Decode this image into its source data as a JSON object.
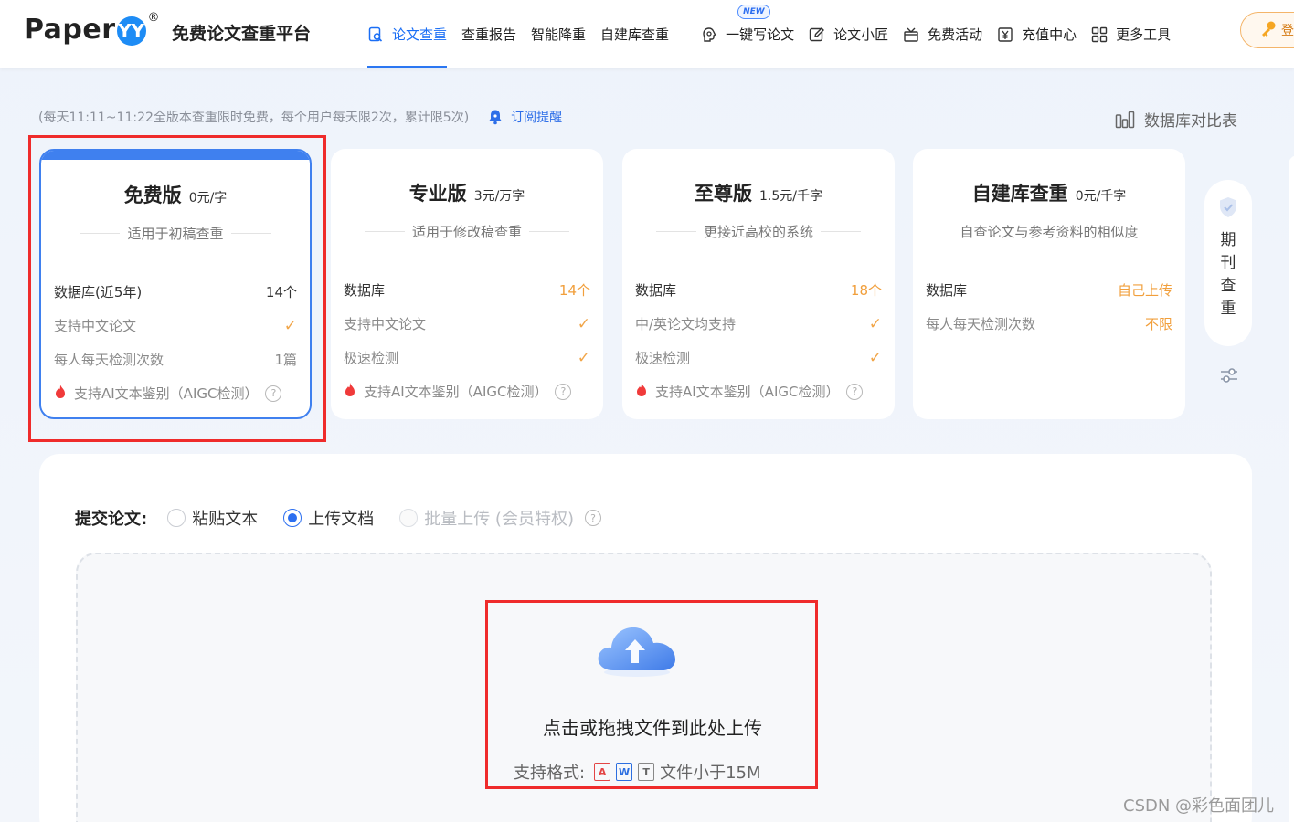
{
  "header": {
    "logo_text": "Paper",
    "logo_badge": "YY",
    "logo_reg": "®",
    "platform_name": "免费论文查重平台",
    "nav": [
      {
        "label": "论文查重",
        "icon": "search-doc-icon"
      },
      {
        "label": "查重报告"
      },
      {
        "label": "智能降重"
      },
      {
        "label": "自建库查重"
      },
      {
        "label": "一键写论文",
        "icon": "ai-brain-icon",
        "badge": "NEW"
      },
      {
        "label": "论文小匠",
        "icon": "pen-icon"
      },
      {
        "label": "免费活动",
        "icon": "gift-icon"
      },
      {
        "label": "充值中心",
        "icon": "yuan-icon"
      },
      {
        "label": "更多工具",
        "icon": "grid-icon"
      }
    ],
    "vip_label": "登"
  },
  "notice": {
    "text": "(每天11:11~11:22全版本查重限时免费，每个用户每天限2次，累计限5次)",
    "subscribe": "订阅提醒",
    "db_compare": "数据库对比表"
  },
  "plans": [
    {
      "name": "免费版",
      "price": "0元/字",
      "desc": "适用于初稿查重",
      "rows": [
        {
          "label": "数据库(近5年)",
          "value": "14个"
        },
        {
          "label": "支持中文论文",
          "value": "✓"
        },
        {
          "label": "每人每天检测次数",
          "value": "1篇"
        }
      ],
      "aigc": "支持AI文本鉴别（AIGC检测）"
    },
    {
      "name": "专业版",
      "price": "3元/万字",
      "desc": "适用于修改稿查重",
      "rows": [
        {
          "label": "数据库",
          "value": "14个"
        },
        {
          "label": "支持中文论文",
          "value": "✓"
        },
        {
          "label": "极速检测",
          "value": "✓"
        }
      ],
      "aigc": "支持AI文本鉴别（AIGC检测）"
    },
    {
      "name": "至尊版",
      "price": "1.5元/千字",
      "desc": "更接近高校的系统",
      "rows": [
        {
          "label": "数据库",
          "value": "18个"
        },
        {
          "label": "中/英论文均支持",
          "value": "✓"
        },
        {
          "label": "极速检测",
          "value": "✓"
        }
      ],
      "aigc": "支持AI文本鉴别（AIGC检测）"
    },
    {
      "name": "自建库查重",
      "price": "0元/千字",
      "desc": "自查论文与参考资料的相似度",
      "rows": [
        {
          "label": "数据库",
          "value": "自己上传"
        },
        {
          "label": "每人每天检测次数",
          "value": "不限"
        }
      ]
    }
  ],
  "side_tab": {
    "label": "期刊查重"
  },
  "submit": {
    "label": "提交论文:",
    "options": [
      {
        "label": "粘贴文本"
      },
      {
        "label": "上传文档"
      },
      {
        "label": "批量上传 (会员特权)"
      }
    ],
    "drop_text": "点击或拖拽文件到此处上传",
    "formats_label": "支持格式:",
    "size_note": "文件小于15M"
  },
  "watermark": "CSDN @彩色面团儿",
  "colors": {
    "accent": "#2b77f2",
    "orange": "#f19f3c",
    "highlight": "#ef2b2b"
  }
}
